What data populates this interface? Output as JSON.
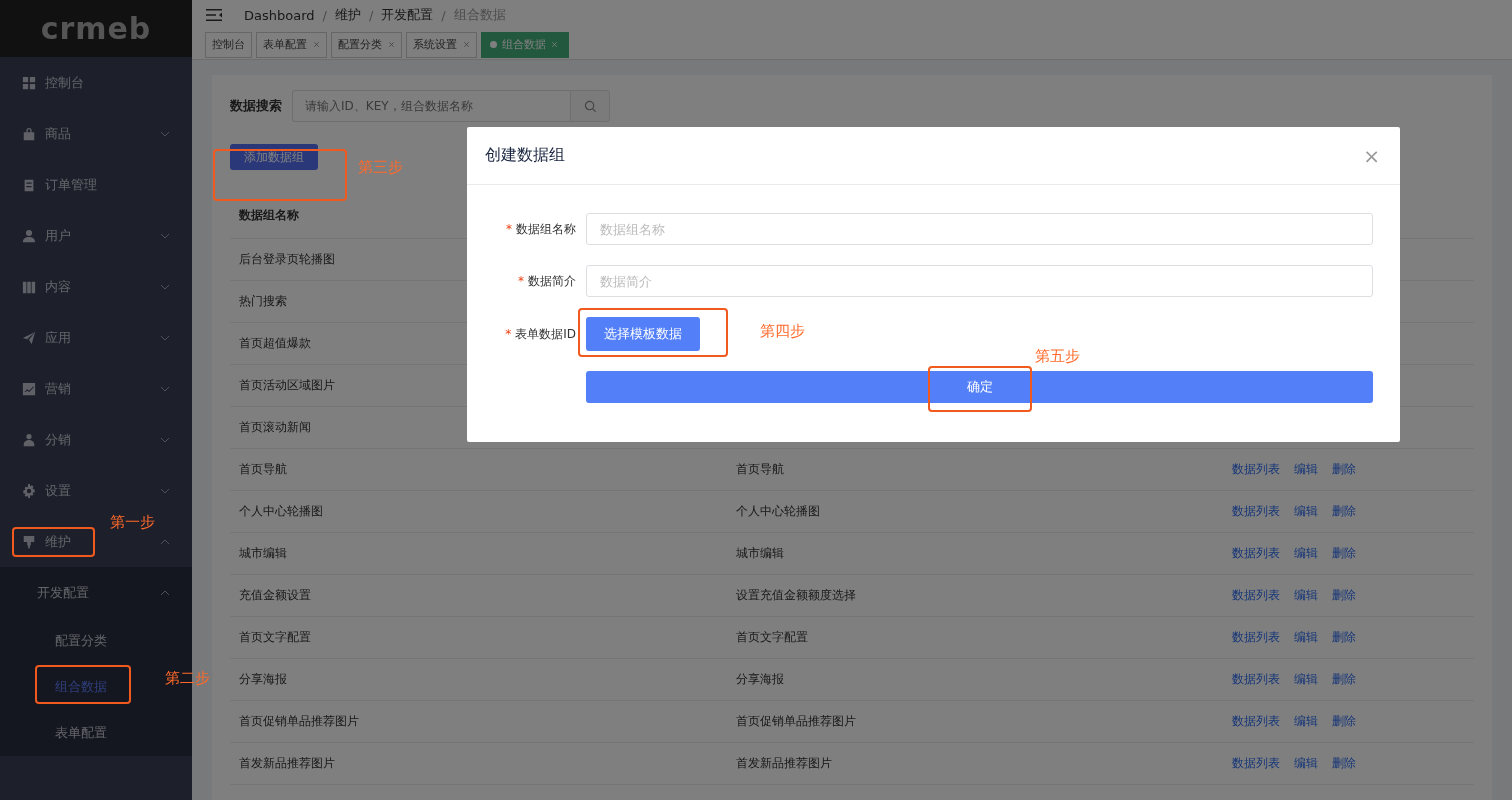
{
  "sidebar": {
    "logo": "crmeb",
    "items": [
      {
        "label": "控制台"
      },
      {
        "label": "商品",
        "expanded": false
      },
      {
        "label": "订单管理"
      },
      {
        "label": "用户",
        "expanded": false
      },
      {
        "label": "内容",
        "expanded": false
      },
      {
        "label": "应用",
        "expanded": false
      },
      {
        "label": "营销",
        "expanded": false
      },
      {
        "label": "分销",
        "expanded": false
      },
      {
        "label": "设置",
        "expanded": false
      },
      {
        "label": "维护",
        "expanded": true,
        "children": [
          {
            "label": "开发配置",
            "expanded": true,
            "children": [
              {
                "label": "配置分类",
                "selected": false
              },
              {
                "label": "组合数据",
                "selected": true
              },
              {
                "label": "表单配置",
                "selected": false
              }
            ]
          }
        ]
      }
    ]
  },
  "breadcrumb": [
    {
      "label": "Dashboard"
    },
    {
      "separator": "/",
      "label": "维护"
    },
    {
      "separator": "/",
      "label": "开发配置"
    },
    {
      "separator": "/",
      "label": "组合数据"
    }
  ],
  "tags": [
    {
      "label": "控制台",
      "closable": false,
      "selected": false
    },
    {
      "label": "表单配置",
      "closable": true,
      "selected": false
    },
    {
      "label": "配置分类",
      "closable": true,
      "selected": false
    },
    {
      "label": "系统设置",
      "closable": true,
      "selected": false
    },
    {
      "label": "组合数据",
      "closable": true,
      "selected": true
    }
  ],
  "search": {
    "label": "数据搜索",
    "placeholder": "请输入ID、KEY，组合数据名称"
  },
  "add_button": "添加数据组",
  "table": {
    "columns": [
      "数据组名称"
    ],
    "rows": [
      {
        "name": "后台登录页轮播图"
      },
      {
        "name": "热门搜索"
      },
      {
        "name": "首页超值爆款"
      },
      {
        "name": "首页活动区域图片"
      },
      {
        "name": "首页滚动新闻"
      },
      {
        "name": "首页导航",
        "description": "首页导航",
        "actions": [
          "数据列表",
          "编辑",
          "删除"
        ]
      },
      {
        "name": "个人中心轮播图",
        "description": "个人中心轮播图",
        "actions": [
          "数据列表",
          "编辑",
          "删除"
        ]
      },
      {
        "name": "城市编辑",
        "description": "城市编辑",
        "actions": [
          "数据列表",
          "编辑",
          "删除"
        ]
      },
      {
        "name": "充值金额设置",
        "description": "设置充值金额额度选择",
        "actions": [
          "数据列表",
          "编辑",
          "删除"
        ]
      },
      {
        "name": "首页文字配置",
        "description": "首页文字配置",
        "actions": [
          "数据列表",
          "编辑",
          "删除"
        ]
      },
      {
        "name": "分享海报",
        "description": "分享海报",
        "actions": [
          "数据列表",
          "编辑",
          "删除"
        ]
      },
      {
        "name": "首页促销单品推荐图片",
        "description": "首页促销单品推荐图片",
        "actions": [
          "数据列表",
          "编辑",
          "删除"
        ]
      },
      {
        "name": "首发新品推荐图片",
        "description": "首发新品推荐图片",
        "actions": [
          "数据列表",
          "编辑",
          "删除"
        ]
      }
    ]
  },
  "dialog": {
    "title": "创建数据组",
    "close": "×",
    "fields": [
      {
        "kind": "input",
        "label": "数据组名称",
        "required_mark": "*",
        "placeholder": "数据组名称"
      },
      {
        "kind": "input",
        "label": "数据简介",
        "required_mark": "*",
        "placeholder": "数据简介"
      },
      {
        "kind": "button",
        "label": "表单数据ID",
        "required_mark": "*",
        "button": "选择模板数据"
      }
    ],
    "submit": "确定"
  },
  "annotations": [
    {
      "text": "第一步"
    },
    {
      "text": "第二步"
    },
    {
      "text": "第三步"
    },
    {
      "text": "第四步"
    },
    {
      "text": "第五步"
    }
  ]
}
